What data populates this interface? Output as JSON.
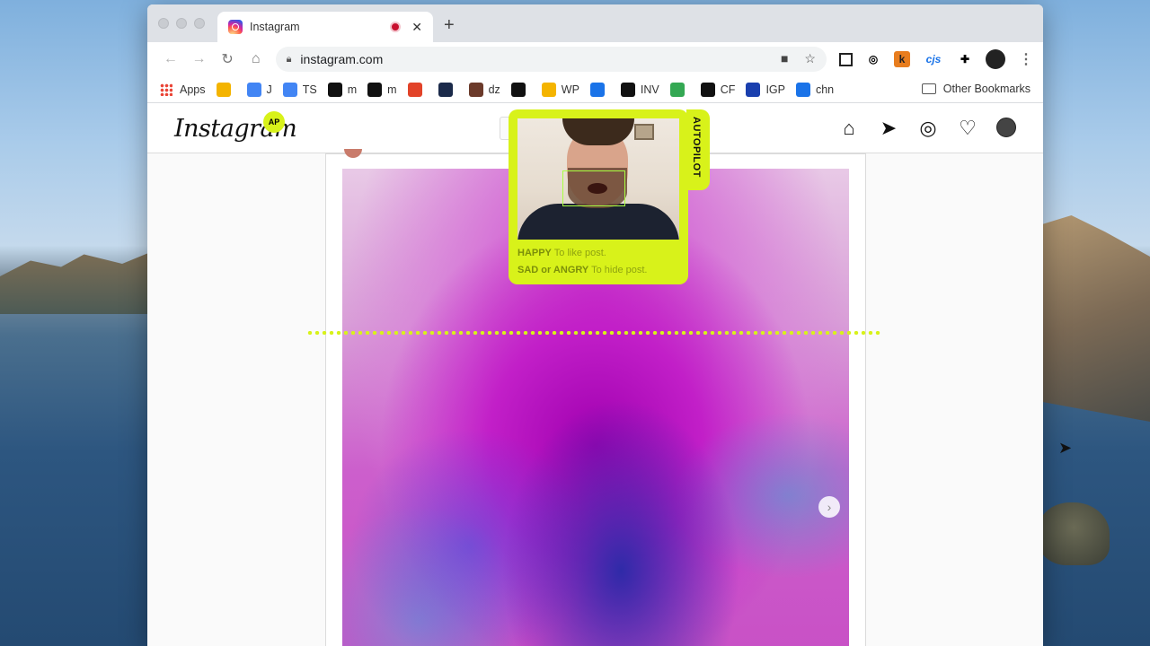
{
  "browser": {
    "tab": {
      "title": "Instagram"
    },
    "url": "instagram.com",
    "extensions": [
      "k",
      "cjs"
    ],
    "bookmarks": [
      {
        "label": "Apps",
        "icon": "apps-grid-icon",
        "color": ""
      },
      {
        "label": "",
        "icon": "lightbulb-icon",
        "color": "#f4b400"
      },
      {
        "label": "J",
        "icon": "docs-icon",
        "color": "#4285f4"
      },
      {
        "label": "TS",
        "icon": "docs-icon",
        "color": "#4285f4"
      },
      {
        "label": "m",
        "icon": "medium-icon",
        "color": "#111111"
      },
      {
        "label": "m",
        "icon": "medium-icon",
        "color": "#111111"
      },
      {
        "label": "",
        "icon": "gitlab-icon",
        "color": "#e24329"
      },
      {
        "label": "",
        "icon": "trophy-icon",
        "color": "#1b2a4a"
      },
      {
        "label": "dz",
        "icon": "photo-icon",
        "color": "#6b3a2a"
      },
      {
        "label": "",
        "icon": "github-icon",
        "color": "#111111"
      },
      {
        "label": "WP",
        "icon": "slides-icon",
        "color": "#f4b400"
      },
      {
        "label": "",
        "icon": "media-icon",
        "color": "#1a73e8"
      },
      {
        "label": "INV",
        "icon": "tumblr-icon",
        "color": "#111111"
      },
      {
        "label": "",
        "icon": "refresh-icon",
        "color": "#34a853"
      },
      {
        "label": "CF",
        "icon": "cf-icon",
        "color": "#111111"
      },
      {
        "label": "IGP",
        "icon": "eu-flag-icon",
        "color": "#1a3fae"
      },
      {
        "label": "chn",
        "icon": "history-icon",
        "color": "#1a73e8"
      }
    ],
    "other_bookmarks": "Other Bookmarks"
  },
  "instagram": {
    "logo": "Instagram",
    "badge": "AP"
  },
  "autopilot": {
    "tab_label": "AUTOPILOT",
    "hints": [
      {
        "emotion": "HAPPY",
        "action": "To like post."
      },
      {
        "emotion": "SAD or ANGRY",
        "action": "To hide post."
      }
    ]
  },
  "colors": {
    "accent": "#d8f21a",
    "tracking_box": "#a8ff40"
  }
}
